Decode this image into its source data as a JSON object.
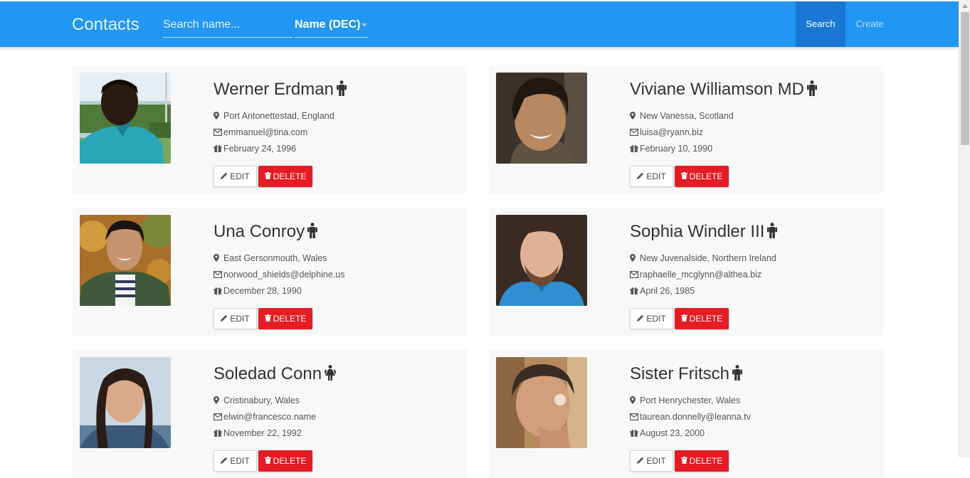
{
  "header": {
    "brand": "Contacts",
    "search_placeholder": "Search name...",
    "sort_value": "Name (DEC)",
    "search_label": "Search",
    "create_label": "Create"
  },
  "buttons": {
    "edit": "EDIT",
    "delete": "DELETE"
  },
  "contacts": [
    {
      "name": "Werner Erdman",
      "gender": "male",
      "location": "Port Antonettestad, England",
      "email": "emmanuel@tina.com",
      "birthday": "February 24, 1996"
    },
    {
      "name": "Viviane Williamson MD",
      "gender": "male",
      "location": "New Vanessa, Scotland",
      "email": "luisa@ryann.biz",
      "birthday": "February 10, 1990"
    },
    {
      "name": "Una Conroy",
      "gender": "male",
      "location": "East Gersonmouth, Wales",
      "email": "norwood_shields@delphine.us",
      "birthday": "December 28, 1990"
    },
    {
      "name": "Sophia Windler III",
      "gender": "male",
      "location": "New Juvenalside, Northern Ireland",
      "email": "raphaelle_mcglynn@althea.biz",
      "birthday": "April 26, 1985"
    },
    {
      "name": "Soledad Conn",
      "gender": "female",
      "location": "Cristinabury, Wales",
      "email": "elwin@francesco.name",
      "birthday": "November 22, 1992"
    },
    {
      "name": "Sister Fritsch",
      "gender": "male",
      "location": "Port Henrychester, Wales",
      "email": "taurean.donnelly@leanna.tv",
      "birthday": "August 23, 2000"
    }
  ]
}
